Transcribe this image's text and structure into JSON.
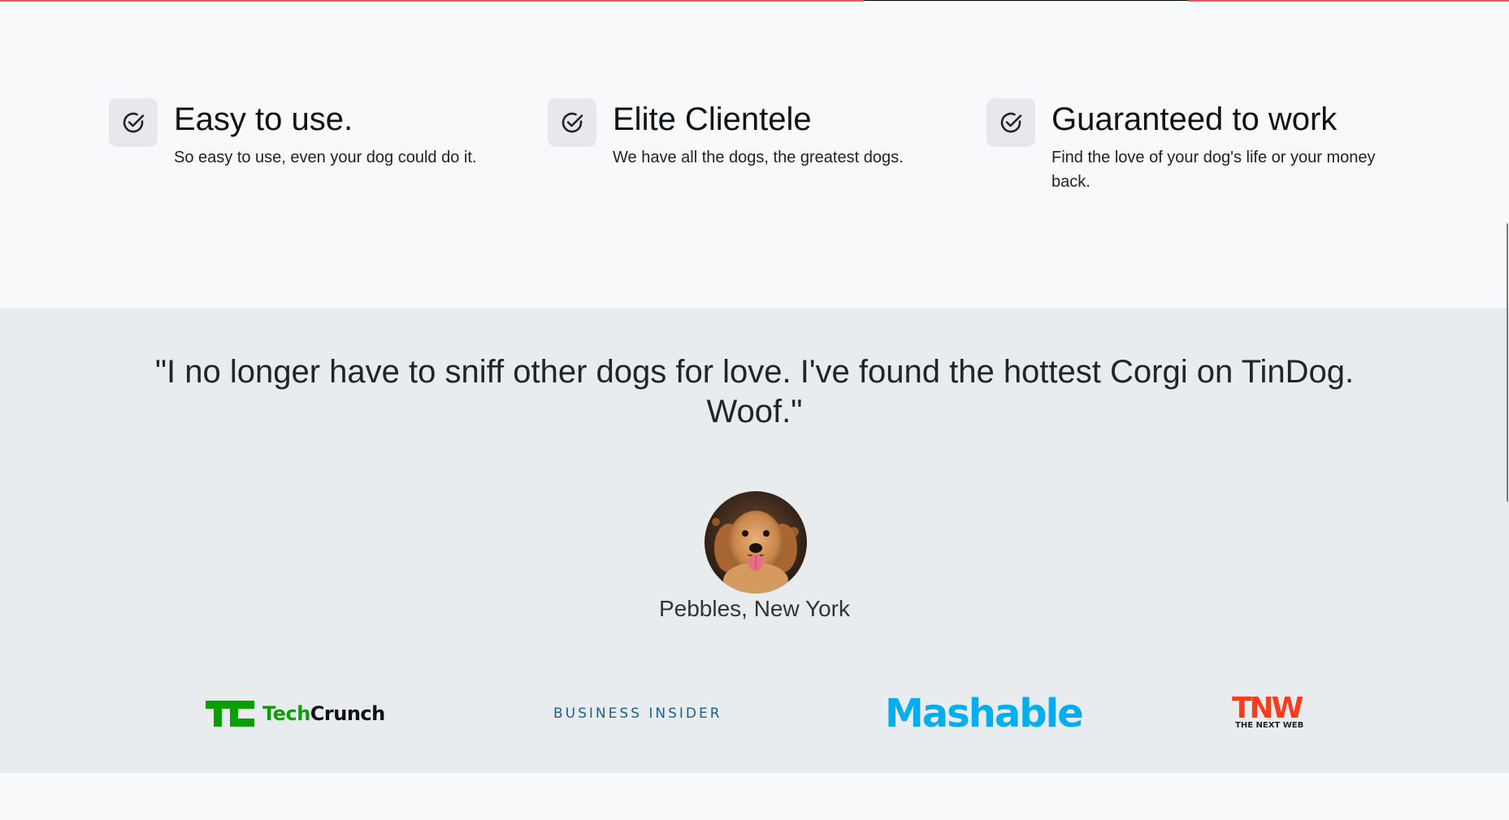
{
  "features": [
    {
      "title": "Easy to use.",
      "description": "So easy to use, even your dog could do it.",
      "icon": "check-circle-icon"
    },
    {
      "title": "Elite Clientele",
      "description": "We have all the dogs, the greatest dogs.",
      "icon": "check-circle-icon"
    },
    {
      "title": "Guaranteed to work",
      "description": "Find the love of your dog's life or your money back.",
      "icon": "check-circle-icon"
    }
  ],
  "testimonial": {
    "quote": "\"I no longer have to sniff other dogs for love. I've found the hottest Corgi on TinDog. Woof.\"",
    "author": "Pebbles, New York",
    "avatar": "golden-retriever-avatar"
  },
  "press": {
    "techcrunch": {
      "name": "TechCrunch",
      "prefix": "Tech",
      "suffix": "Crunch"
    },
    "business_insider": {
      "name": "BUSINESS INSIDER"
    },
    "mashable": {
      "name": "Mashable"
    },
    "tnw": {
      "big": "TNW",
      "small": "THE NEXT WEB"
    }
  },
  "colors": {
    "features_bg": "#f8f9fa",
    "testimonials_bg": "#e9ecef",
    "techcrunch_green": "#0a9e01",
    "business_insider_blue": "#1f5f8a",
    "mashable_blue": "#00aeef",
    "tnw_red": "#ff3c1f"
  }
}
